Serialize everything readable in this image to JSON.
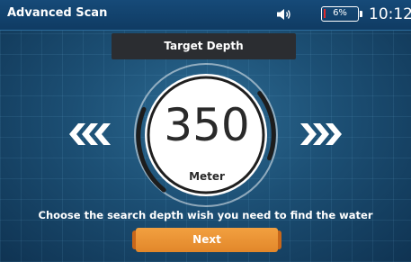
{
  "status_bar": {
    "title": "Advanced Scan",
    "battery": {
      "label": "6%",
      "level": 0.06,
      "color": "#e02a2a"
    },
    "clock": "10:12",
    "speaker_icon": "speaker-icon"
  },
  "depth_panel": {
    "header": "Target Depth",
    "value": "350",
    "unit": "Meter",
    "decrease_icon": "triple-chevron-left-icon",
    "increase_icon": "triple-chevron-right-icon"
  },
  "instruction": "Choose the search depth wish you need to find the water",
  "next_button": {
    "label": "Next"
  },
  "colors": {
    "accent": "#e88f2d",
    "header_bg": "#2b2d31",
    "status_bar_bg": "#164a78"
  }
}
